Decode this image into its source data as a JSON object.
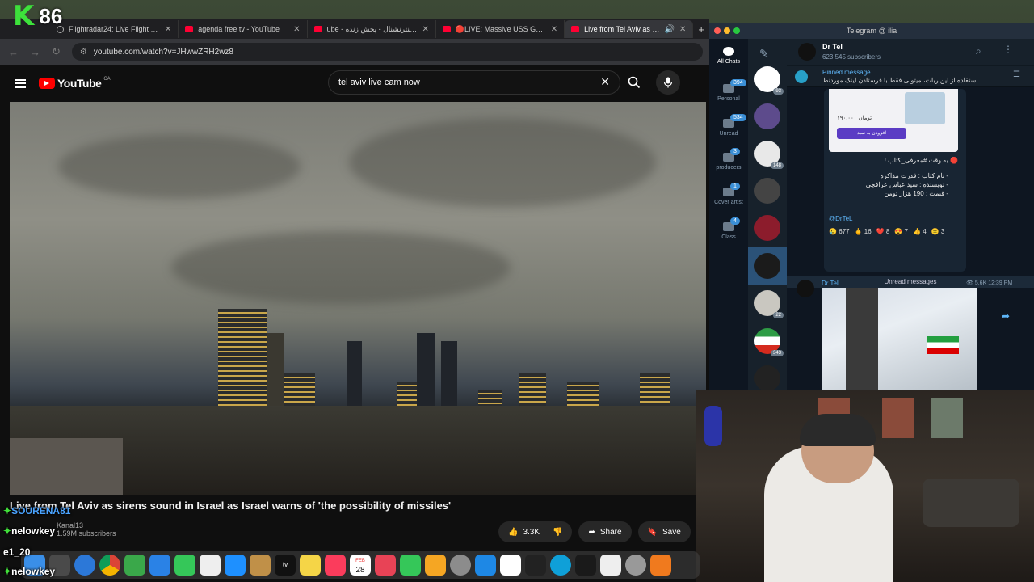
{
  "stream": {
    "logo": "K",
    "count": "86"
  },
  "browser": {
    "tabs": [
      {
        "label": "Flightradar24: Live Flight Tra",
        "icon": "globe-icon"
      },
      {
        "label": "agenda free tv - YouTube",
        "icon": "youtube-icon"
      },
      {
        "label": "ube - ایران اینترنشنال - پخش زنده",
        "icon": "youtube-icon"
      },
      {
        "label": "🔴LIVE: Massive USS Gerald",
        "icon": "youtube-icon"
      },
      {
        "label": "Live from Tel Aviv as siren",
        "icon": "youtube-icon",
        "active": true
      }
    ],
    "url": "youtube.com/watch?v=JHwwZRH2wz8"
  },
  "youtube": {
    "logo_text": "YouTube",
    "country": "CA",
    "search_query": "tel aviv live cam now",
    "video_title": "Live from Tel Aviv as sirens sound in Israel as Israel warns of 'the possibility of missiles'",
    "channel": "Kanal13",
    "subscribers": "1.59M subscribers",
    "likes": "3.3K",
    "share_label": "Share",
    "save_label": "Save"
  },
  "chat_overlay": [
    {
      "user": "SOURENA81"
    },
    {
      "user": "nelowkey"
    },
    {
      "user": "e1_20"
    },
    {
      "user": "nelowkey"
    }
  ],
  "telegram": {
    "window_title": "Telegram @ ilia",
    "channel_name": "Dr Tel",
    "subscribers": "623,545 subscribers",
    "pinned_label": "Pinned message",
    "pinned_text": "ستفاده از این ربات، میتونی فقط با فرستادن لینک موردنظ...",
    "folders": [
      {
        "label": "All Chats",
        "count": ""
      },
      {
        "label": "Personal",
        "count": "394"
      },
      {
        "label": "Unread",
        "count": "534"
      },
      {
        "label": "producers",
        "count": "3"
      },
      {
        "label": "Cover artist",
        "count": "1"
      },
      {
        "label": "Class",
        "count": "4"
      }
    ],
    "chat_badges": [
      "93",
      "148",
      "22",
      "343"
    ],
    "post_header": "🔴 به وقت #معرفی_کتاب !",
    "post_lines": [
      "- نام کتاب : قدرت مذاکره",
      "- نویسنده : سید عباس عراقچی",
      "- قیمت : 190 هزار تومن"
    ],
    "post_handle": "@DrTeL",
    "reactions": [
      {
        "emoji": "😢",
        "count": "677"
      },
      {
        "emoji": "🖕",
        "count": "16"
      },
      {
        "emoji": "❤️",
        "count": "8"
      },
      {
        "emoji": "😍",
        "count": "7"
      },
      {
        "emoji": "👍",
        "count": "4"
      },
      {
        "emoji": "😐",
        "count": "3"
      }
    ],
    "price_card": "۱۹۰,۰۰۰ تومان",
    "buy_label": "افزودن به سبد",
    "unread_label": "Unread messages",
    "second_sender": "Dr Tel",
    "second_meta": "5.6K 12:39 PM"
  },
  "dock": {
    "calendar_day": "28",
    "calendar_month": "FEB",
    "tv_label": "tv"
  }
}
